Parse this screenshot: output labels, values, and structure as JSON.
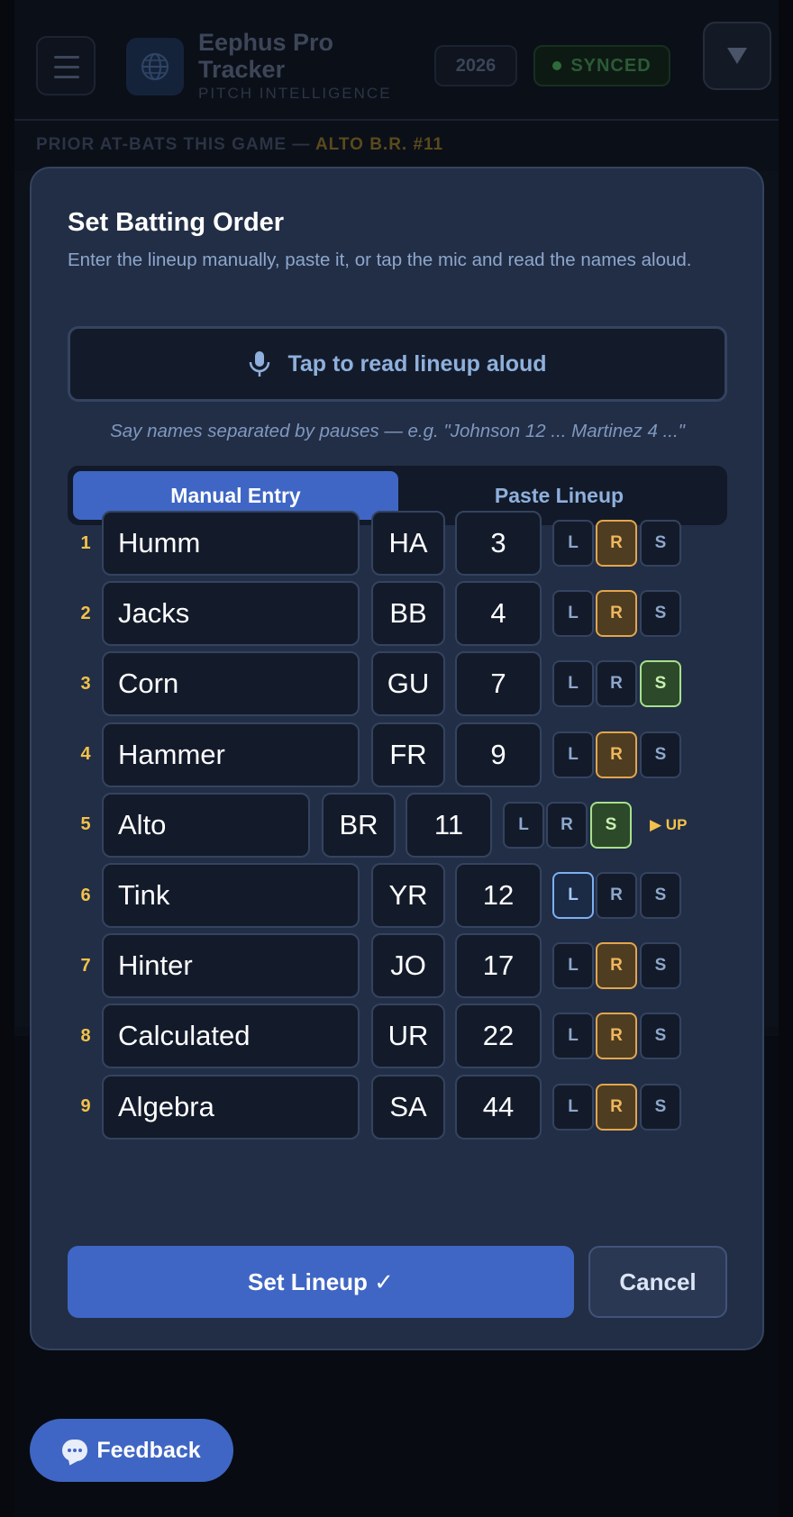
{
  "header": {
    "app_title": "Eephus Pro Tracker",
    "app_subtitle": "PITCH INTELLIGENCE",
    "year": "2026",
    "sync_status": "SYNCED"
  },
  "prior_at_bats": {
    "label": "PRIOR AT-BATS THIS GAME — ",
    "batter": "ALTO B.R. #11"
  },
  "modal": {
    "title": "Set Batting Order",
    "description": "Enter the lineup manually, paste it, or tap the mic and read the names aloud.",
    "mic_button_label": "Tap to read lineup aloud",
    "hint": "Say names separated by pauses — e.g. \"Johnson 12 ... Martinez 4 ...\"",
    "tabs": [
      {
        "label": "Manual Entry",
        "active": true
      },
      {
        "label": "Paste Lineup",
        "active": false
      }
    ],
    "lineup": [
      {
        "order": "1",
        "name": "Humm",
        "team": "HA",
        "jersey": "3",
        "bats": "R"
      },
      {
        "order": "2",
        "name": "Jacks",
        "team": "BB",
        "jersey": "4",
        "bats": "R"
      },
      {
        "order": "3",
        "name": "Corn",
        "team": "GU",
        "jersey": "7",
        "bats": "S"
      },
      {
        "order": "4",
        "name": "Hammer",
        "team": "FR",
        "jersey": "9",
        "bats": "R"
      },
      {
        "order": "5",
        "name": "Alto",
        "team": "BR",
        "jersey": "11",
        "bats": "S",
        "tag": "▶ UP"
      },
      {
        "order": "6",
        "name": "Tink",
        "team": "YR",
        "jersey": "12",
        "bats": "L"
      },
      {
        "order": "7",
        "name": "Hinter",
        "team": "JO",
        "jersey": "17",
        "bats": "R"
      },
      {
        "order": "8",
        "name": "Calculated",
        "team": "UR",
        "jersey": "22",
        "bats": "R"
      },
      {
        "order": "9",
        "name": "Algebra",
        "team": "SA",
        "jersey": "44",
        "bats": "R"
      }
    ],
    "hand_options": [
      "L",
      "R",
      "S"
    ],
    "set_button_label": "Set Lineup ✓",
    "cancel_button_label": "Cancel"
  },
  "feedback_label": "Feedback",
  "colors": {
    "accent": "#3f66c4",
    "order_number": "#f3c24a",
    "right_selected": "#e3a64b",
    "switch_selected": "#a7e08c",
    "left_selected": "#7db0f2",
    "modal_bg": "#222e46"
  }
}
